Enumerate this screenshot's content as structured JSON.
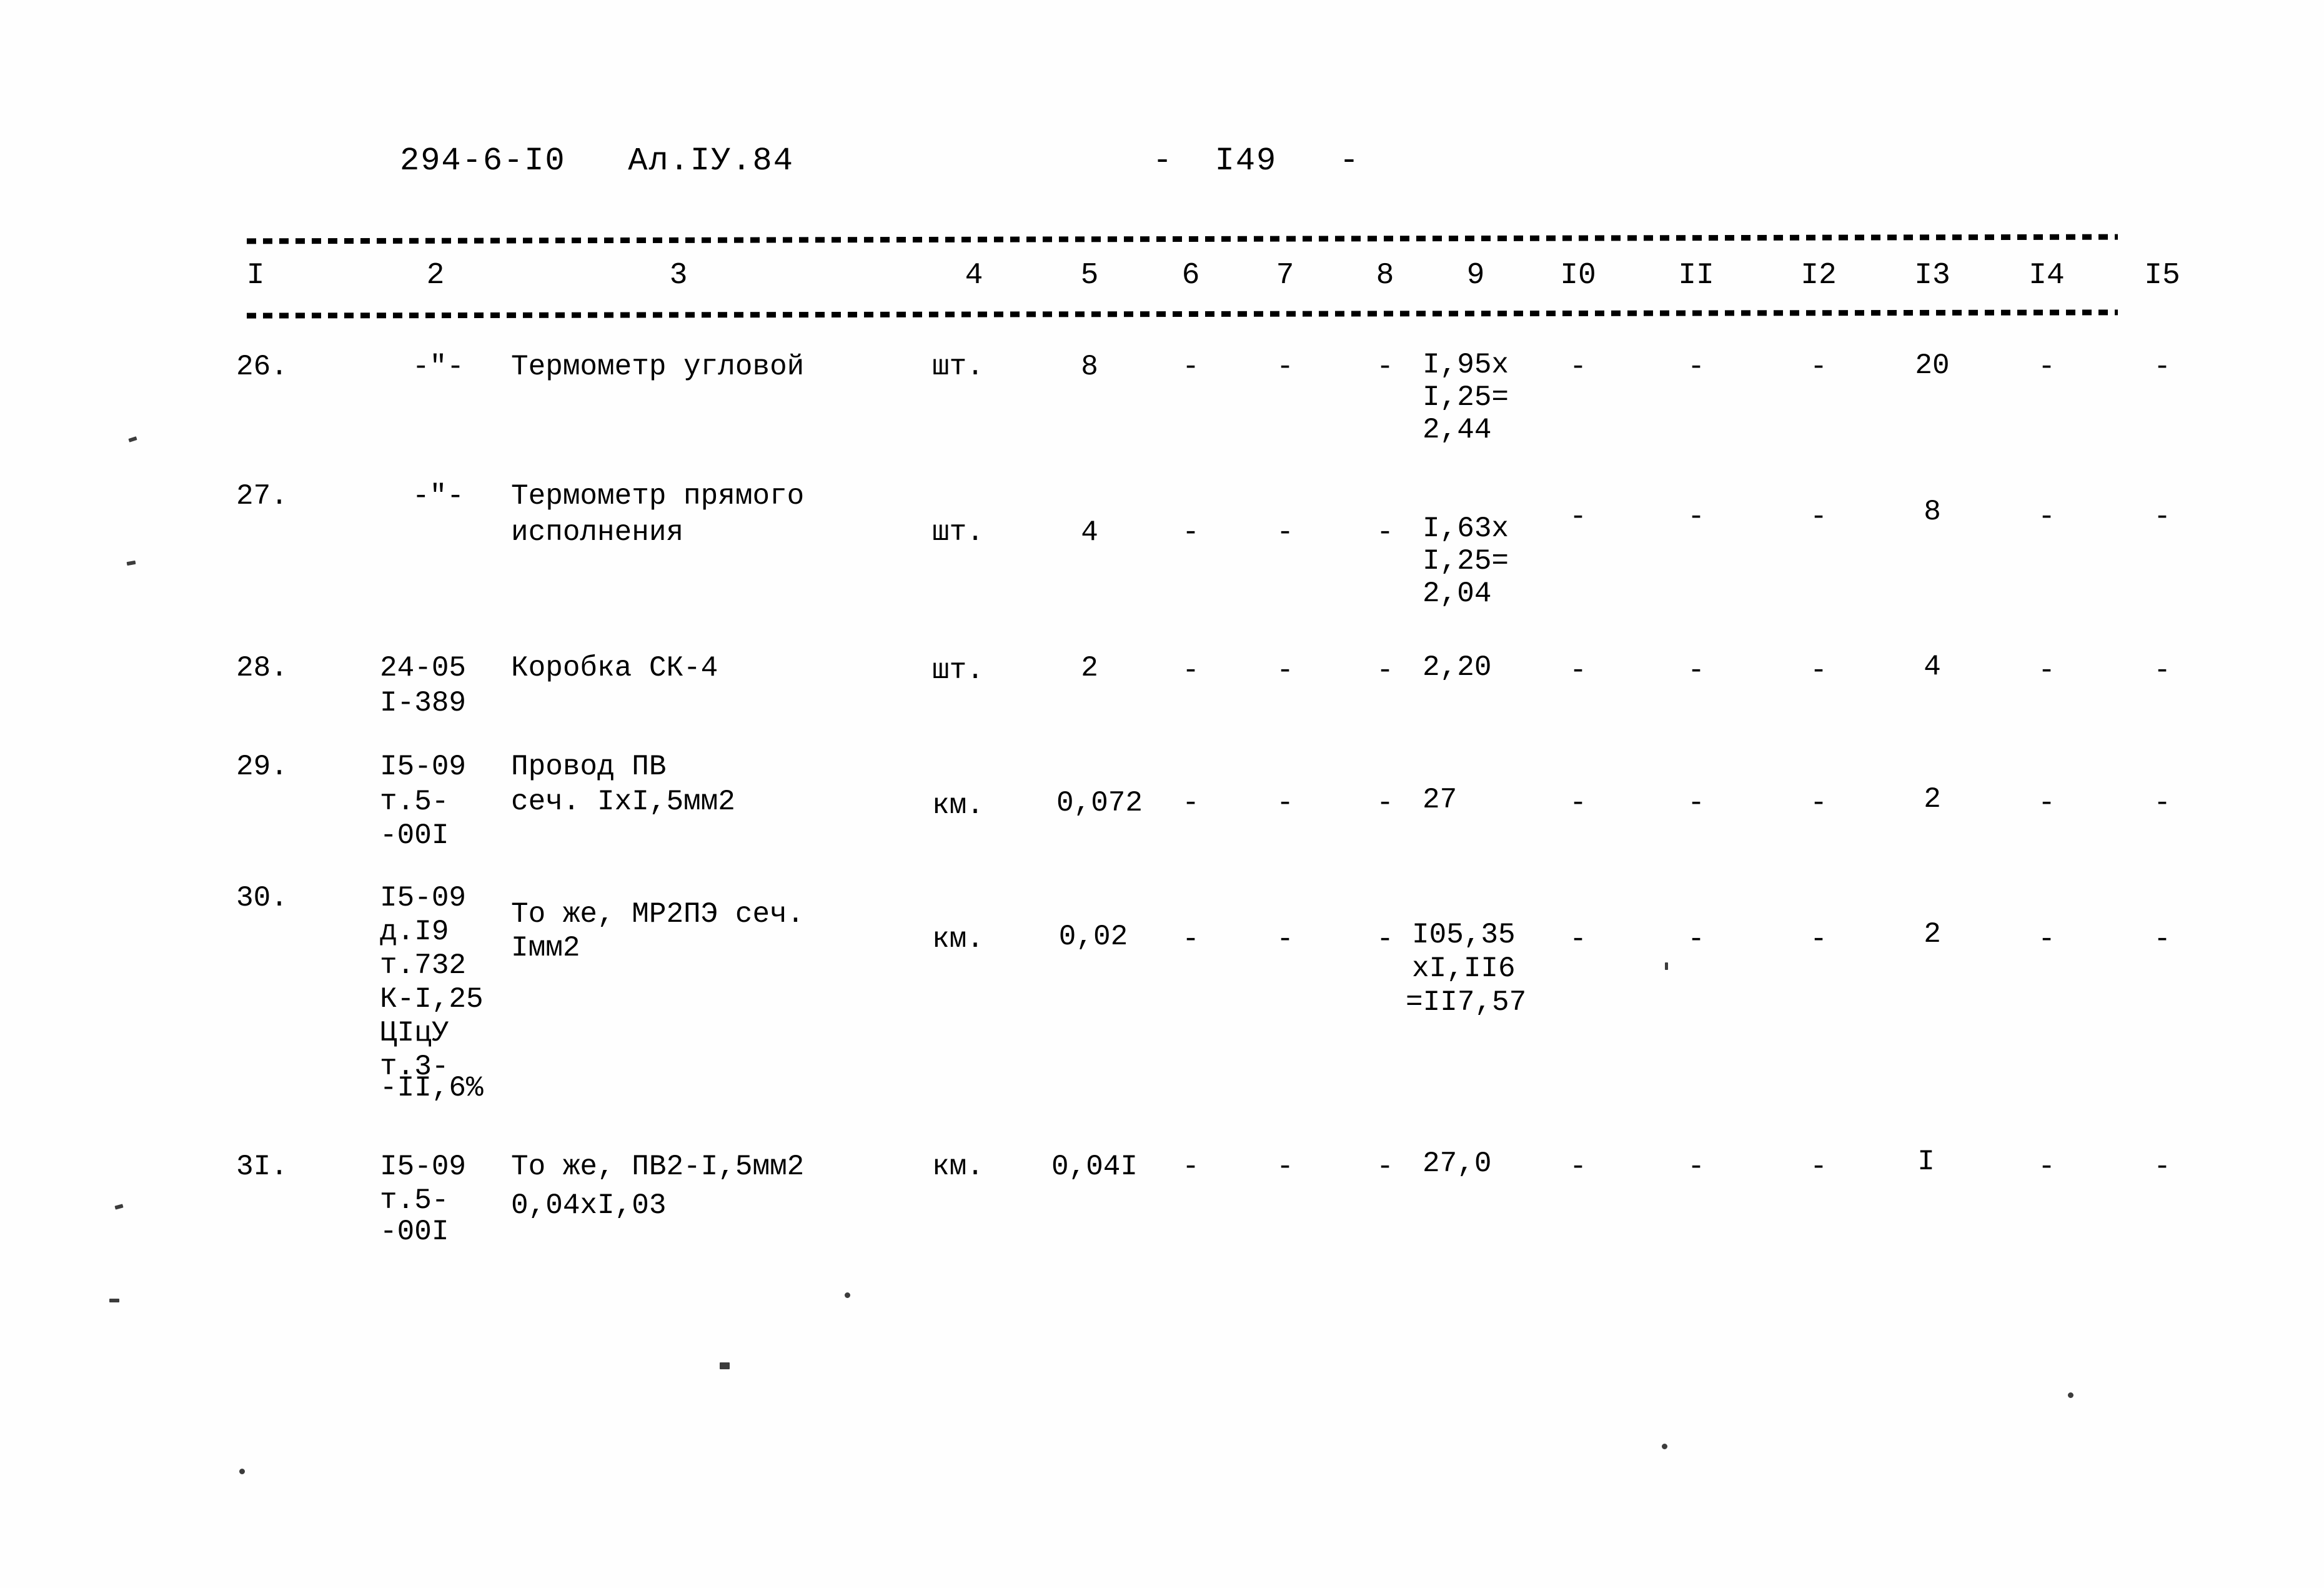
{
  "document": {
    "header_code": "294-6-I0   Ал.IУ.84",
    "page_marker": "-  I49   -"
  },
  "table": {
    "column_headers": [
      "I",
      "2",
      "3",
      "4",
      "5",
      "6",
      "7",
      "8",
      "9",
      "I0",
      "II",
      "I2",
      "I3",
      "I4",
      "I5"
    ],
    "dash": "-",
    "rows": [
      {
        "num": "26.",
        "code": "-\"-",
        "name_line1": "Термометр угловой",
        "name_line2": "",
        "unit": "шт.",
        "qty": "8",
        "c6": "-",
        "c7": "-",
        "c8": "-",
        "c9_line1": "I,95x",
        "c9_line2": "I,25=",
        "c9_line3": "2,44",
        "c10": "-",
        "c11": "-",
        "c12": "-",
        "c13": "20",
        "c14": "-",
        "c15": "-"
      },
      {
        "num": "27.",
        "code": "-\"-",
        "name_line1": "Термометр прямого",
        "name_line2": "исполнения",
        "unit": "шт.",
        "qty": "4",
        "c6": "-",
        "c7": "-",
        "c8": "-",
        "c9_line1": "I,63x",
        "c9_line2": "I,25=",
        "c9_line3": "2,04",
        "c10": "-",
        "c11": "-",
        "c12": "-",
        "c13": "8",
        "c14": "-",
        "c15": "-"
      },
      {
        "num": "28.",
        "code_line1": "24-05",
        "code_line2": "I-389",
        "name_line1": "Коробка СК-4",
        "name_line2": "",
        "unit": "шт.",
        "qty": "2",
        "c6": "-",
        "c7": "-",
        "c8": "-",
        "c9_line1": "2,20",
        "c9_line2": "",
        "c9_line3": "",
        "c10": "-",
        "c11": "-",
        "c12": "-",
        "c13": "4",
        "c14": "-",
        "c15": "-"
      },
      {
        "num": "29.",
        "code_line1": "I5-09",
        "code_line2": "т.5-",
        "code_line3": "-00I",
        "name_line1": "Провод ПВ",
        "name_line2": "сеч. IxI,5мм2",
        "unit": "км.",
        "qty": "0,072",
        "c6": "-",
        "c7": "-",
        "c8": "-",
        "c9_line1": "27",
        "c9_line2": "",
        "c9_line3": "",
        "c10": "-",
        "c11": "-",
        "c12": "-",
        "c13": "2",
        "c14": "-",
        "c15": "-"
      },
      {
        "num": "30.",
        "code_line1": "I5-09",
        "code_line2": "д.I9",
        "code_line3": "т.732",
        "code_line4": "К-I,25",
        "code_line5": "ЦIцУ",
        "code_line6": "т.3-",
        "code_line7": "-II,6%",
        "name_line1": "То же, МР2ПЭ сеч.",
        "name_line2": "Iмм2",
        "unit": "км.",
        "qty": "0,02",
        "c6": "-",
        "c7": "-",
        "c8": "-",
        "c9_line1": "I05,35",
        "c9_line2": "xI,II6",
        "c9_line3": "=II7,57",
        "c10": "-",
        "c11": "-",
        "c12": "-",
        "c13": "2",
        "c14": "-",
        "c15": "-"
      },
      {
        "num": "3I.",
        "code_line1": "I5-09",
        "code_line2": "т.5-",
        "code_line3": "-00I",
        "name_line1": "То же, ПВ2-I,5мм2",
        "name_line2": "0,04xI,03",
        "unit": "км.",
        "qty": "0,04I",
        "c6": "-",
        "c7": "-",
        "c8": "-",
        "c9_line1": "27,0",
        "c9_line2": "",
        "c9_line3": "",
        "c10": "-",
        "c11": "-",
        "c12": "-",
        "c13": "I",
        "c14": "-",
        "c15": "-"
      }
    ]
  }
}
